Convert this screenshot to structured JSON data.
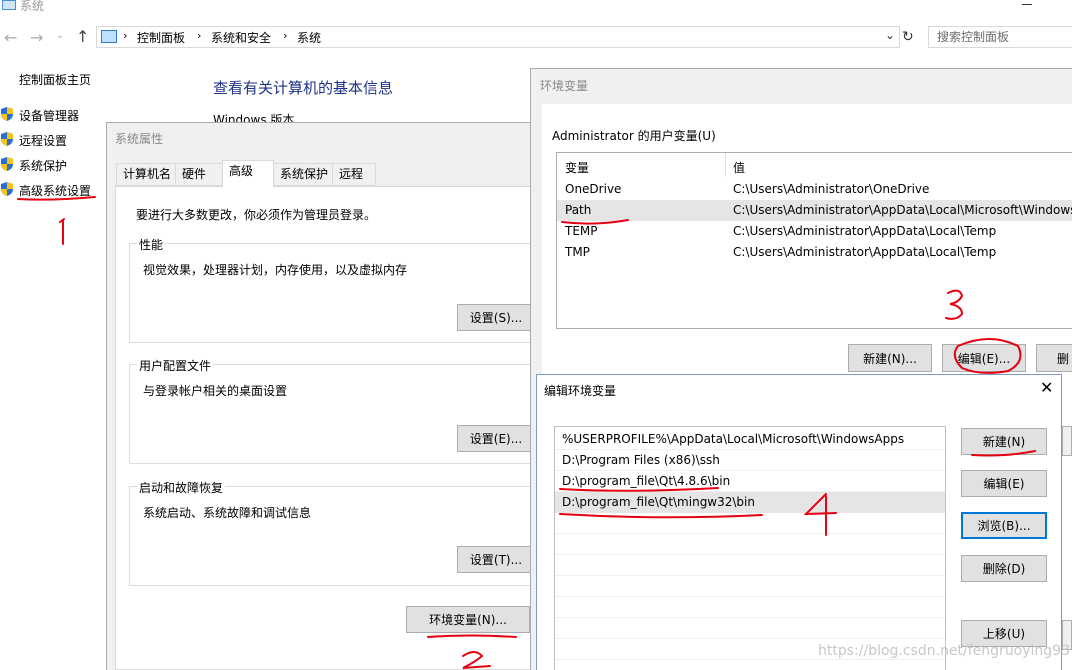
{
  "window": {
    "title": "系统",
    "breadcrumb": [
      "控制面板",
      "系统和安全",
      "系统"
    ],
    "search_placeholder": "搜索控制面板"
  },
  "sidebar": {
    "home": "控制面板主页",
    "items": [
      {
        "label": "设备管理器"
      },
      {
        "label": "远程设置"
      },
      {
        "label": "系统保护"
      },
      {
        "label": "高级系统设置"
      }
    ]
  },
  "main": {
    "heading": "查看有关计算机的基本信息",
    "windows_edition": "Windows 版本"
  },
  "system_properties": {
    "title": "系统属性",
    "tabs": [
      "计算机名",
      "硬件",
      "高级",
      "系统保护",
      "远程"
    ],
    "active_tab": "高级",
    "admin_note": "要进行大多数更改，你必须作为管理员登录。",
    "performance": {
      "title": "性能",
      "desc": "视觉效果，处理器计划，内存使用，以及虚拟内存",
      "button": "设置(S)..."
    },
    "user_profiles": {
      "title": "用户配置文件",
      "desc": "与登录帐户相关的桌面设置",
      "button": "设置(E)..."
    },
    "startup": {
      "title": "启动和故障恢复",
      "desc": "系统启动、系统故障和调试信息",
      "button": "设置(T)..."
    },
    "env_button": "环境变量(N)..."
  },
  "env_vars": {
    "title": "环境变量",
    "user_vars_label": "Administrator 的用户变量(U)",
    "columns": [
      "变量",
      "值"
    ],
    "rows": [
      {
        "name": "OneDrive",
        "value": "C:\\Users\\Administrator\\OneDrive"
      },
      {
        "name": "Path",
        "value": "C:\\Users\\Administrator\\AppData\\Local\\Microsoft\\WindowsApps"
      },
      {
        "name": "TEMP",
        "value": "C:\\Users\\Administrator\\AppData\\Local\\Temp"
      },
      {
        "name": "TMP",
        "value": "C:\\Users\\Administrator\\AppData\\Local\\Temp"
      }
    ],
    "buttons": {
      "new": "新建(N)...",
      "edit": "编辑(E)...",
      "delete": "删"
    }
  },
  "edit_env": {
    "title": "编辑环境变量",
    "entries": [
      "%USERPROFILE%\\AppData\\Local\\Microsoft\\WindowsApps",
      "D:\\Program Files (x86)\\ssh",
      "D:\\program_file\\Qt\\4.8.6\\bin",
      "D:\\program_file\\Qt\\mingw32\\bin"
    ],
    "buttons": {
      "new": "新建(N)",
      "edit": "编辑(E)",
      "browse": "浏览(B)...",
      "delete": "删除(D)",
      "move_up": "上移(U)"
    }
  },
  "annotations": [
    "1",
    "2",
    "3",
    "4"
  ],
  "watermark": "https://blog.csdn.net/fengruoying93"
}
